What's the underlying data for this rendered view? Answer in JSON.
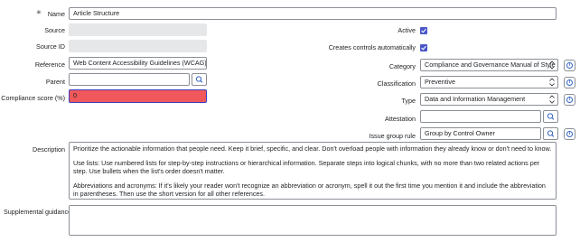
{
  "left": {
    "name_label": "Name",
    "name_required": "✳",
    "name_value": "Article Structure",
    "source_label": "Source",
    "source_value": "",
    "source_id_label": "Source ID",
    "source_id_value": "",
    "reference_label": "Reference",
    "reference_value": "Web Content Accessibility Guidelines (WCAG)",
    "parent_label": "Parent",
    "parent_value": "",
    "compliance_label": "Compliance score (%)",
    "compliance_value": "0"
  },
  "right": {
    "active_label": "Active",
    "active_checked": true,
    "creates_controls_label": "Creates controls automatically",
    "creates_controls_checked": true,
    "category_label": "Category",
    "category_value": "Compliance and Governance Manual of Style",
    "classification_label": "Classification",
    "classification_value": "Preventive",
    "type_label": "Type",
    "type_value": "Data and Information Management",
    "attestation_label": "Attestation",
    "attestation_value": "",
    "issue_group_label": "Issue group rule",
    "issue_group_value": "Group by Control Owner"
  },
  "description": {
    "label": "Description",
    "paragraphs": [
      "Prioritize the actionable information that people need. Keep it brief, specific, and clear. Don't overload people with information they already know or don't need to know.",
      "Use lists: Use numbered lists for step-by-step instructions or hierarchical information. Separate steps into logical chunks, with no more than two related actions per step. Use bullets when the list's order doesn't matter.",
      "Abbreviations and acronyms: If it's likely your reader won't recognize an abbreviation or acronym, spell it out the first time you mention it and include the abbreviation in parentheses. Then use the short version for all other references."
    ]
  },
  "supplemental": {
    "label": "Supplemental guidance",
    "value": ""
  },
  "colors": {
    "checkbox": "#4a57c9",
    "error_field": "#f0585b",
    "readonly_field": "#e6e7e9"
  },
  "icons": [
    "search-icon",
    "info-icon",
    "chevron-down-icon",
    "checkmark-icon",
    "required-asterisk-icon"
  ]
}
